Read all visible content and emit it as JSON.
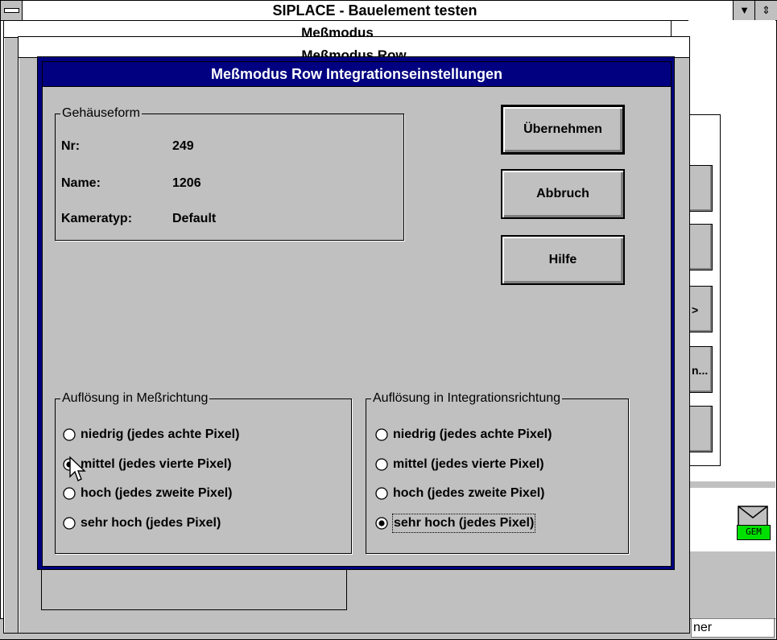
{
  "main_window": {
    "title": "SIPLACE - Bauelement testen",
    "minimize_glyph": "▼",
    "restore_glyph": "⇕"
  },
  "background_windows": {
    "window2_title": "Meßmodus",
    "window3_title": "Meßmodus Row"
  },
  "right_side": {
    "button_glyphs": [
      "",
      "",
      ">",
      "n...",
      ""
    ],
    "status_text": "ner",
    "gem_label": "GEM"
  },
  "dialog": {
    "title": "Meßmodus Row Integrationseinstellungen",
    "housing_group": {
      "legend": "Gehäuseform",
      "rows": [
        {
          "label": "Nr:",
          "value": "249"
        },
        {
          "label": "Name:",
          "value": "1206"
        },
        {
          "label": "Kameratyp:",
          "value": "Default"
        }
      ]
    },
    "buttons": {
      "apply": "Übernehmen",
      "cancel": "Abbruch",
      "help": "Hilfe"
    },
    "measure_direction_group": {
      "legend": "Auflösung in Meßrichtung",
      "selected_index": 1,
      "options": [
        "niedrig (jedes achte Pixel)",
        "mittel (jedes vierte Pixel)",
        "hoch (jedes zweite Pixel)",
        "sehr hoch (jedes Pixel)"
      ]
    },
    "integration_direction_group": {
      "legend": "Auflösung in Integrationsrichtung",
      "selected_index": 3,
      "focused_index": 3,
      "options": [
        "niedrig (jedes achte Pixel)",
        "mittel (jedes vierte Pixel)",
        "hoch (jedes zweite Pixel)",
        "sehr hoch (jedes Pixel)"
      ]
    }
  },
  "icons": {
    "system_menu": "system-menu-icon",
    "radio_selected": "radio-selected-icon",
    "radio_unselected": "radio-unselected-icon",
    "mouse_cursor": "mouse-pointer-icon",
    "mail": "mail-envelope-icon"
  },
  "colors": {
    "dialog_title_bg": "#000080",
    "face": "#c0c0c0",
    "gem_green": "#00e000"
  }
}
